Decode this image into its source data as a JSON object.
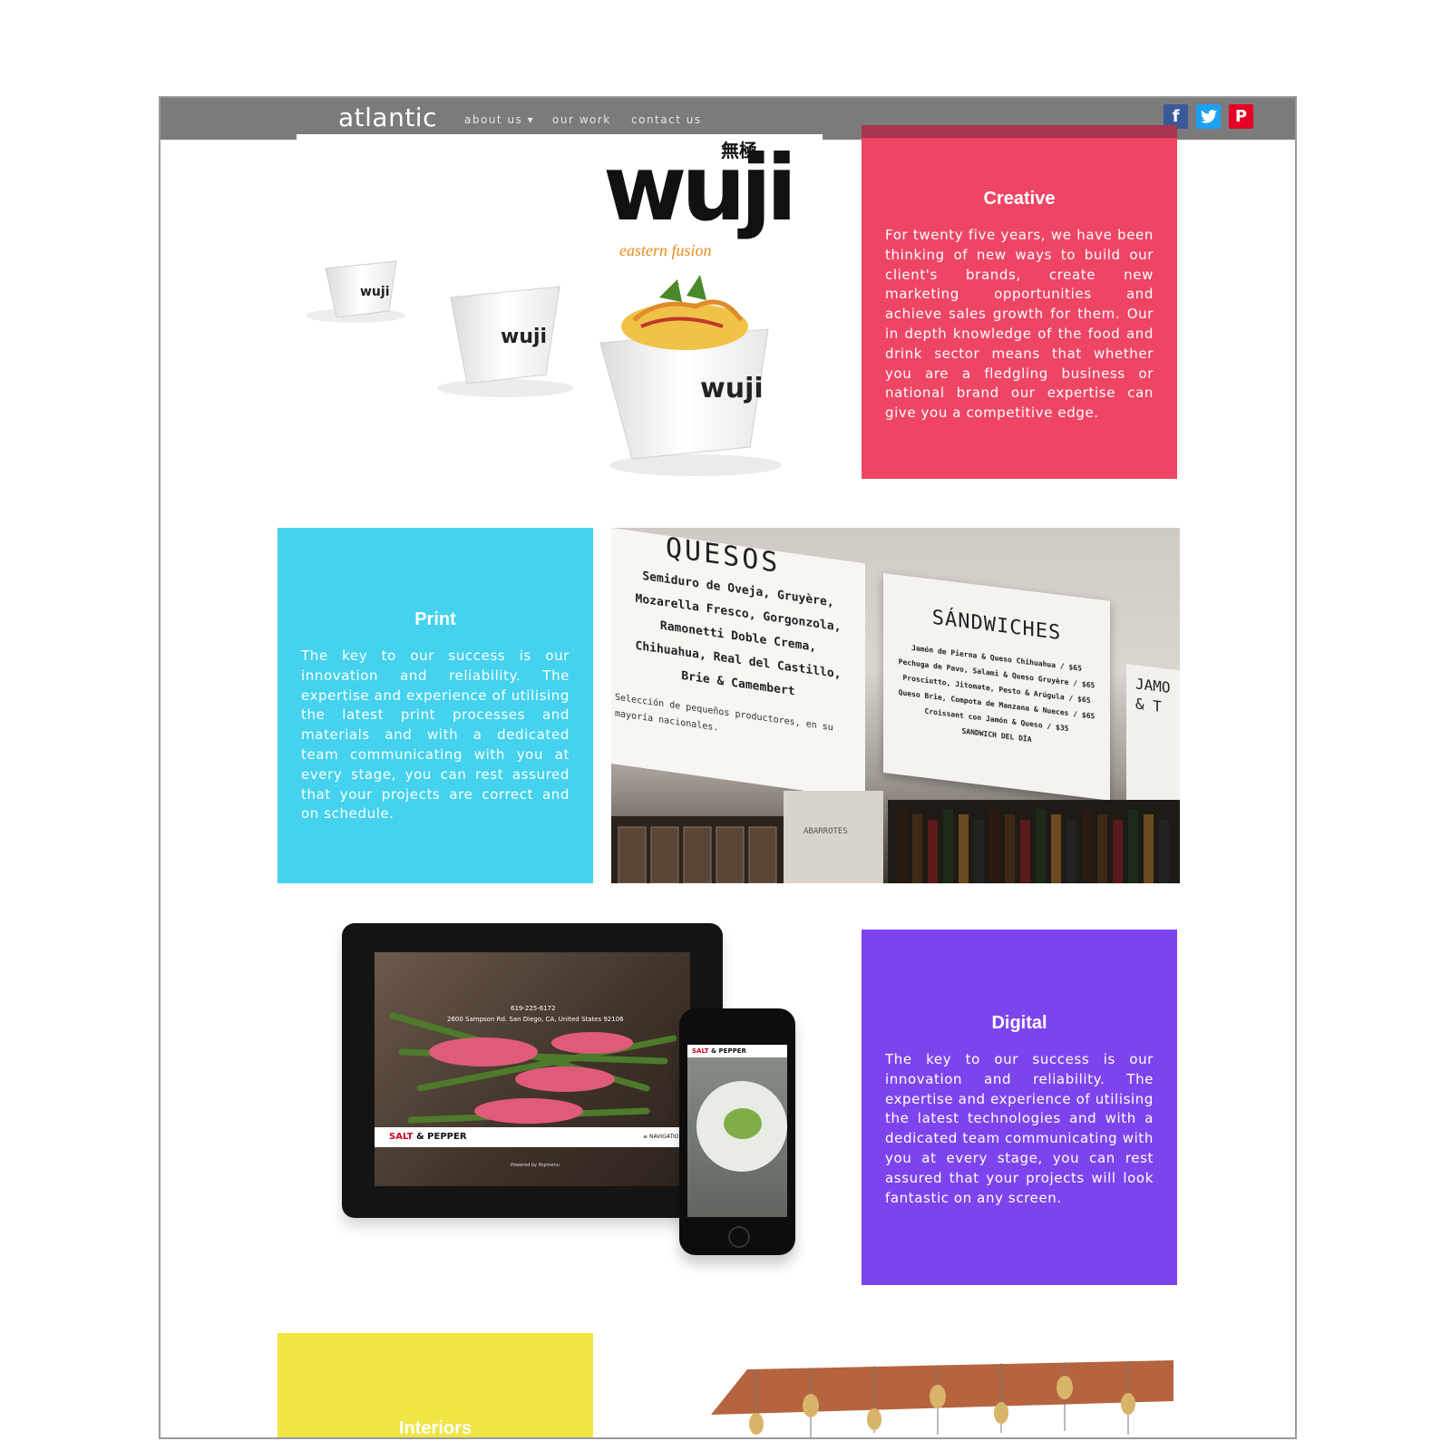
{
  "header": {
    "brand": "atlantic",
    "nav": [
      {
        "label": "about us ▾"
      },
      {
        "label": "our work"
      },
      {
        "label": "contact us"
      }
    ],
    "social": [
      {
        "icon": "facebook-icon",
        "glyph": "f",
        "color": "#3b5998"
      },
      {
        "icon": "twitter-icon",
        "glyph": "t",
        "color": "#1da1f2"
      },
      {
        "icon": "pinterest-icon",
        "glyph": "P",
        "color": "#e60023"
      }
    ]
  },
  "wuji": {
    "kanji": "無極",
    "logo": "wuji",
    "tagline": "eastern fusion"
  },
  "sections": {
    "creative": {
      "title": "Creative",
      "body": "For twenty five years, we have been thinking of new ways to build our client's brands, create new marketing opportunities and achieve sales growth for them. Our in depth knowledge of the food and drink sector means that whether you are a fledgling business or national brand our expertise can give you a competitive edge.",
      "color": "#ef4565"
    },
    "print": {
      "title": "Print",
      "body": "The key to our success is our innovation and reliability. The expertise and experience of utilising the latest print processes and materials and with a dedicated team communicating with you at every stage, you can rest assured that your projects are correct and on schedule.",
      "color": "#44d2ee"
    },
    "digital": {
      "title": "Digital",
      "body": "The key to our success is our innovation and reliability. The expertise and experience of utilising the latest technologies and with a dedicated team communicating with you at every stage, you can rest assured that your projects will look fantastic on any screen.",
      "color": "#7d44ee"
    },
    "interiors": {
      "title": "Interiors",
      "color": "#f0e545"
    }
  },
  "menu_photo": {
    "quesos_heading": "QUESOS",
    "quesos_lines": [
      "Semiduro de Oveja, Gruyère,",
      "Mozarella Fresco, Gorgonzola,",
      "Ramonetti Doble Crema,",
      "Chihuahua, Real del Castillo,",
      "Brie & Camembert"
    ],
    "quesos_note": "Selección de pequeños productores, en su mayoría nacionales.",
    "sandwiches_heading": "SÁNDWICHES",
    "sandwiches_lines": [
      "Jamón de Pierna & Queso Chihuahua / $65",
      "Pechuga de Pavo, Salami & Queso Gruyère / $65",
      "Prosciutto, Jitomate, Pesto & Arúgula / $65",
      "Queso Brie, Compota de Manzana & Nueces / $65",
      "Croissant con Jamón & Queso / $35",
      "SANDWICH DEL DÍA"
    ],
    "third_heading": "JAMO & T",
    "box_label": "ABARROTES"
  },
  "devices": {
    "tablet_phone": "619-225-6172",
    "tablet_address": "2600 Sampson Rd. San Diego, CA, United States 92106",
    "brand_salt": "SALT",
    "brand_rest": " & PEPPER",
    "navigation": "≡ NAVIGATION",
    "powered": "Powered by Popmenu"
  }
}
